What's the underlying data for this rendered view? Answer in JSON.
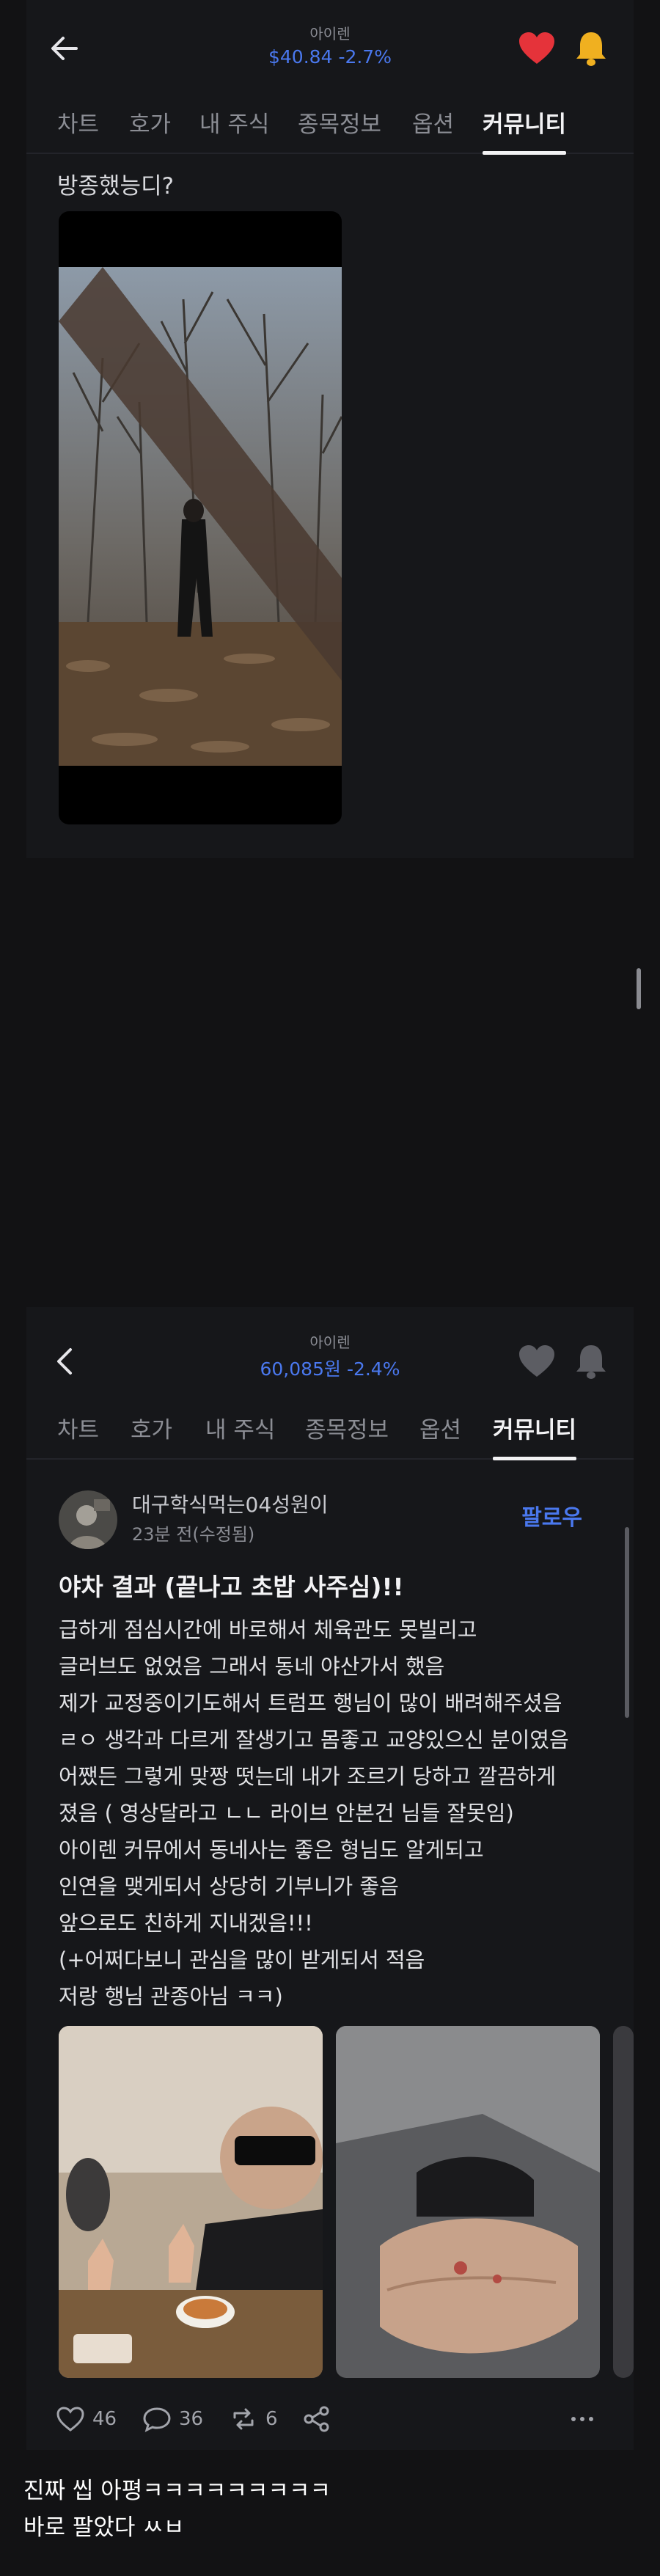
{
  "screen1": {
    "header": {
      "stock_name": "아이렌",
      "price": "$40.84",
      "change": "-2.7%",
      "heart_color": "#e5333a",
      "bell_color": "#f0b020"
    },
    "tabs": [
      "차트",
      "호가",
      "내 주식",
      "종목정보",
      "옵션",
      "커뮤니티"
    ],
    "active_tab": "커뮤니티",
    "post": {
      "title": "방종했능디?"
    }
  },
  "screen2": {
    "header": {
      "stock_name": "아이렌",
      "price": "60,085원",
      "change": "-2.4%"
    },
    "tabs": [
      "차트",
      "호가",
      "내 주식",
      "종목정보",
      "옵션",
      "커뮤니티"
    ],
    "active_tab": "커뮤니티",
    "post": {
      "author": "대구학식먹는04성원이",
      "time": "23분 전(수정됨)",
      "follow_label": "팔로우",
      "title": "야차 결과 (끝나고 초밥 사주심)!!",
      "body_lines": [
        "급하게 점심시간에 바로해서 체육관도 못빌리고",
        "글러브도 없었음 그래서 동네 야산가서 했음",
        "제가 교정중이기도해서 트럼프 행님이 많이 배려해주셨음",
        "ㄹㅇ 생각과 다르게 잘생기고 몸좋고 교양있으신 분이였음",
        "어쨌든 그렇게 맞짱 떳는데 내가 조르기 당하고 깔끔하게",
        "졌음 ( 영상달라고 ㄴㄴ 라이브 안본건 님들 잘못임)",
        "아이렌 커뮤에서 동네사는 좋은 형님도 알게되고",
        "인연을 맺게되서 상당히 기부니가 좋음",
        "앞으로도 친하게 지내겠음!!!",
        "(+어쩌다보니 관심을 많이 받게되서 적음",
        "저랑 행님 관종아님 ㅋㅋ)"
      ],
      "likes": "46",
      "comments": "36",
      "reposts": "6"
    }
  },
  "caption": {
    "line1": "진짜 씹 아평ㅋㅋㅋㅋㅋㅋㅋㅋㅋ",
    "line2": "바로 팔았다 ㅆㅂ"
  },
  "colors": {
    "accent": "#4a78ee",
    "background": "#121214",
    "panel": "#16171a"
  }
}
